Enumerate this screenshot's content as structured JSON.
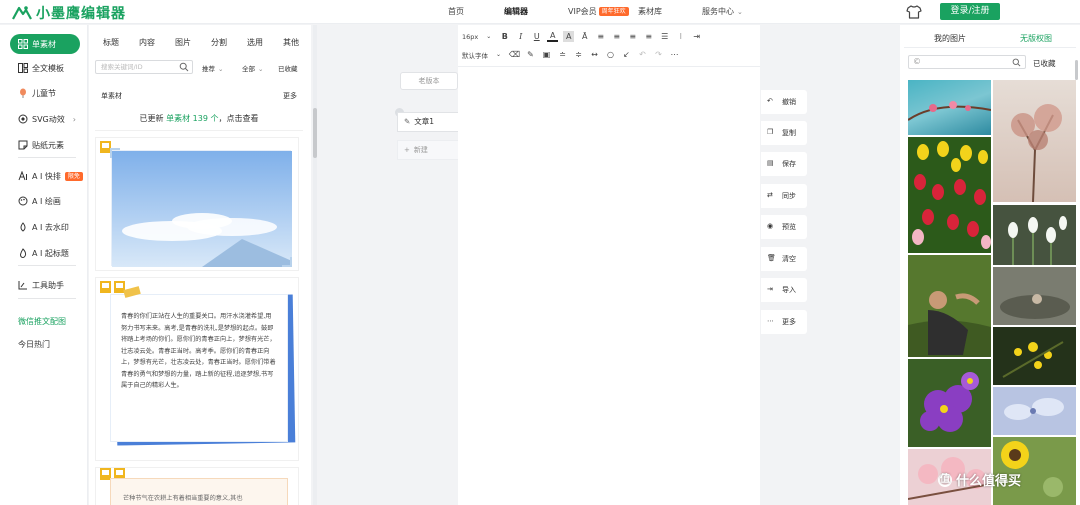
{
  "brand": {
    "name": "小墨鹰编辑器",
    "color": "#1aa260"
  },
  "nav": {
    "home": "首页",
    "editor": "编辑器",
    "vip": "VIP会员",
    "vip_badge": "周年狂欢",
    "library": "素材库",
    "service": "服务中心"
  },
  "header": {
    "login": "登录/注册"
  },
  "sidebar": {
    "items": [
      {
        "label": "单素材",
        "icon": "grid-icon"
      },
      {
        "label": "全文模板",
        "icon": "template-icon"
      },
      {
        "label": "儿童节",
        "icon": "balloon-icon"
      },
      {
        "label": "SVG动效",
        "icon": "svg-icon"
      },
      {
        "label": "贴纸元素",
        "icon": "sticker-icon"
      },
      {
        "label": "A I 快排",
        "icon": "ai-icon",
        "badge": "限免"
      },
      {
        "label": "A I 绘画",
        "icon": "palette-icon"
      },
      {
        "label": "A I 去水印",
        "icon": "drop-icon"
      },
      {
        "label": "A I 起标题",
        "icon": "fire-icon"
      },
      {
        "label": "工具助手",
        "icon": "tool-icon"
      },
      {
        "label": "微信推文配图"
      },
      {
        "label": "今日热门"
      }
    ]
  },
  "materials": {
    "tabs": [
      "标题",
      "内容",
      "图片",
      "分割",
      "选用",
      "其他"
    ],
    "search_placeholder": "搜索关键词/ID",
    "filters": {
      "recommend": "推荐",
      "all": "全部",
      "favorites": "已收藏"
    },
    "section_title": "单素材",
    "section_more": "更多",
    "update_prefix": "已更新",
    "update_highlight": "单素材 139 个",
    "update_suffix": "，点击查看",
    "card2_text": "青春的你们正站在人生的重要关口。用汗水浇灌希望,用努力书写未来。高考,是青春的洗礼,是梦想的起点。鼓即将踏上考场的你们。愿你们的青春正向上，梦想有光芒，壮志凌云处。青春正当时。高考季。愿你们的青春正向上，梦想有光芒，壮志凌云处，青春正当时。愿你们带着青春的勇气和梦想的力量，踏上新的征程,追逐梦想,书写属于自己的精彩人生。",
    "card3_text": "芒种节气在农耕上有着相当重要的意义,其也"
  },
  "editor": {
    "old_version": "老版本",
    "doc_tab": "文章1",
    "new_doc": "新建",
    "font_size": "16px",
    "font_family": "默认字体"
  },
  "actions": [
    "撤销",
    "复制",
    "保存",
    "同步",
    "预览",
    "清空",
    "导入",
    "更多"
  ],
  "right_panel": {
    "tab_mine": "我的图片",
    "tab_free": "无版权图",
    "favorites": "已收藏"
  },
  "watermark": "什么值得买"
}
